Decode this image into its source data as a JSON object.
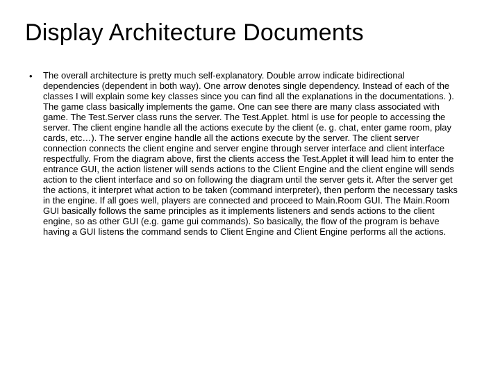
{
  "slide": {
    "title": "Display Architecture Documents",
    "bullet_glyph": "•",
    "body": "The overall architecture is pretty much self-explanatory.  Double arrow indicate bidirectional dependencies (dependent in both way).  One arrow denotes single dependency.  Instead of each of the classes I will explain some key classes since you can find all the explanations in the documentations. ).  The game class basically implements the game.  One can see there are many class associated with game.  The Test.Server class runs the server.  The Test.Applet. html is use for people to accessing the server.  The client engine handle all the actions execute by the client (e. g. chat, enter game room, play cards, etc…).  The server engine handle all the actions execute by the server.  The client server connection connects the client engine and server engine through server interface and client interface respectfully.  From the diagram above, first the clients access the Test.Applet it will lead him to enter the entrance GUI, the action listener will sends actions to the Client Engine and the client engine will sends action to the client interface and so on following the diagram until the server gets it.  After the server get the actions, it interpret what action to be taken (command interpreter), then perform the necessary tasks in the engine.  If all goes well, players are connected and proceed to Main.Room GUI.  The Main.Room GUI basically follows the same principles as it implements listeners and sends actions to the client engine, so as other GUI (e.g. game gui commands).  So basically, the flow of the program is behave having a GUI listens the command sends to Client Engine and Client Engine performs all the actions."
  }
}
